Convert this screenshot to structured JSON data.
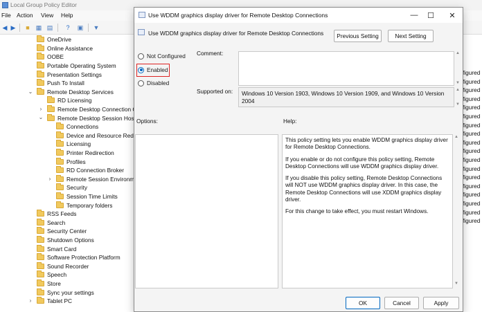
{
  "app": {
    "title": "Local Group Policy Editor"
  },
  "menu": {
    "items": [
      "File",
      "Action",
      "View",
      "Help"
    ]
  },
  "tree": {
    "items": [
      {
        "label": "OneDrive",
        "level": 0,
        "expander": ""
      },
      {
        "label": "Online Assistance",
        "level": 0,
        "expander": ""
      },
      {
        "label": "OOBE",
        "level": 0,
        "expander": ""
      },
      {
        "label": "Portable Operating System",
        "level": 0,
        "expander": ""
      },
      {
        "label": "Presentation Settings",
        "level": 0,
        "expander": ""
      },
      {
        "label": "Push To Install",
        "level": 0,
        "expander": ""
      },
      {
        "label": "Remote Desktop Services",
        "level": 0,
        "expander": "v"
      },
      {
        "label": "RD Licensing",
        "level": 1,
        "expander": ""
      },
      {
        "label": "Remote Desktop Connection C",
        "level": 1,
        "expander": ">"
      },
      {
        "label": "Remote Desktop Session Host",
        "level": 1,
        "expander": "v"
      },
      {
        "label": "Connections",
        "level": 2,
        "expander": ""
      },
      {
        "label": "Device and Resource Redir",
        "level": 2,
        "expander": ""
      },
      {
        "label": "Licensing",
        "level": 2,
        "expander": ""
      },
      {
        "label": "Printer Redirection",
        "level": 2,
        "expander": ""
      },
      {
        "label": "Profiles",
        "level": 2,
        "expander": ""
      },
      {
        "label": "RD Connection Broker",
        "level": 2,
        "expander": ""
      },
      {
        "label": "Remote Session Environme",
        "level": 2,
        "expander": ">"
      },
      {
        "label": "Security",
        "level": 2,
        "expander": ""
      },
      {
        "label": "Session Time Limits",
        "level": 2,
        "expander": ""
      },
      {
        "label": "Temporary folders",
        "level": 2,
        "expander": ""
      },
      {
        "label": "RSS Feeds",
        "level": 0,
        "expander": ""
      },
      {
        "label": "Search",
        "level": 0,
        "expander": ""
      },
      {
        "label": "Security Center",
        "level": 0,
        "expander": ""
      },
      {
        "label": "Shutdown Options",
        "level": 0,
        "expander": ""
      },
      {
        "label": "Smart Card",
        "level": 0,
        "expander": ""
      },
      {
        "label": "Software Protection Platform",
        "level": 0,
        "expander": ""
      },
      {
        "label": "Sound Recorder",
        "level": 0,
        "expander": ""
      },
      {
        "label": "Speech",
        "level": 0,
        "expander": ""
      },
      {
        "label": "Store",
        "level": 0,
        "expander": ""
      },
      {
        "label": "Sync your settings",
        "level": 0,
        "expander": ""
      },
      {
        "label": "Tablet PC",
        "level": 0,
        "expander": ">"
      }
    ]
  },
  "right_column": {
    "items": [
      "figured",
      "figured",
      "figured",
      "figured",
      "figured",
      "figured",
      "figured",
      "figured",
      "figured",
      "figured",
      "figured",
      "figured",
      "figured",
      "figured",
      "figured",
      "figured",
      "figured",
      "figured"
    ]
  },
  "dialog": {
    "title": "Use WDDM graphics display driver for Remote Desktop Connections",
    "header_title": "Use WDDM graphics display driver for Remote Desktop Connections",
    "previous_setting": "Previous Setting",
    "next_setting": "Next Setting",
    "radios": [
      {
        "label": "Not Configured",
        "checked": false
      },
      {
        "label": "Enabled",
        "checked": true
      },
      {
        "label": "Disabled",
        "checked": false
      }
    ],
    "comment_label": "Comment:",
    "supported_label": "Supported on:",
    "supported_value": "Windows 10 Version 1903, Windows 10 Version 1909, and Windows 10 Version 2004",
    "options_label": "Options:",
    "help_label": "Help:",
    "help_paragraphs": [
      "This policy setting lets you enable WDDM graphics display driver for Remote Desktop Connections.",
      "If you enable or do not configure this policy setting, Remote Desktop Connections will use WDDM graphics display driver.",
      "If you disable this policy setting, Remote Desktop Connections will NOT use WDDM graphics display driver. In this case, the Remote Desktop Connections will use XDDM graphics display driver.",
      "For this change to take effect, you must restart Windows."
    ],
    "ok": "OK",
    "cancel": "Cancel",
    "apply": "Apply"
  }
}
